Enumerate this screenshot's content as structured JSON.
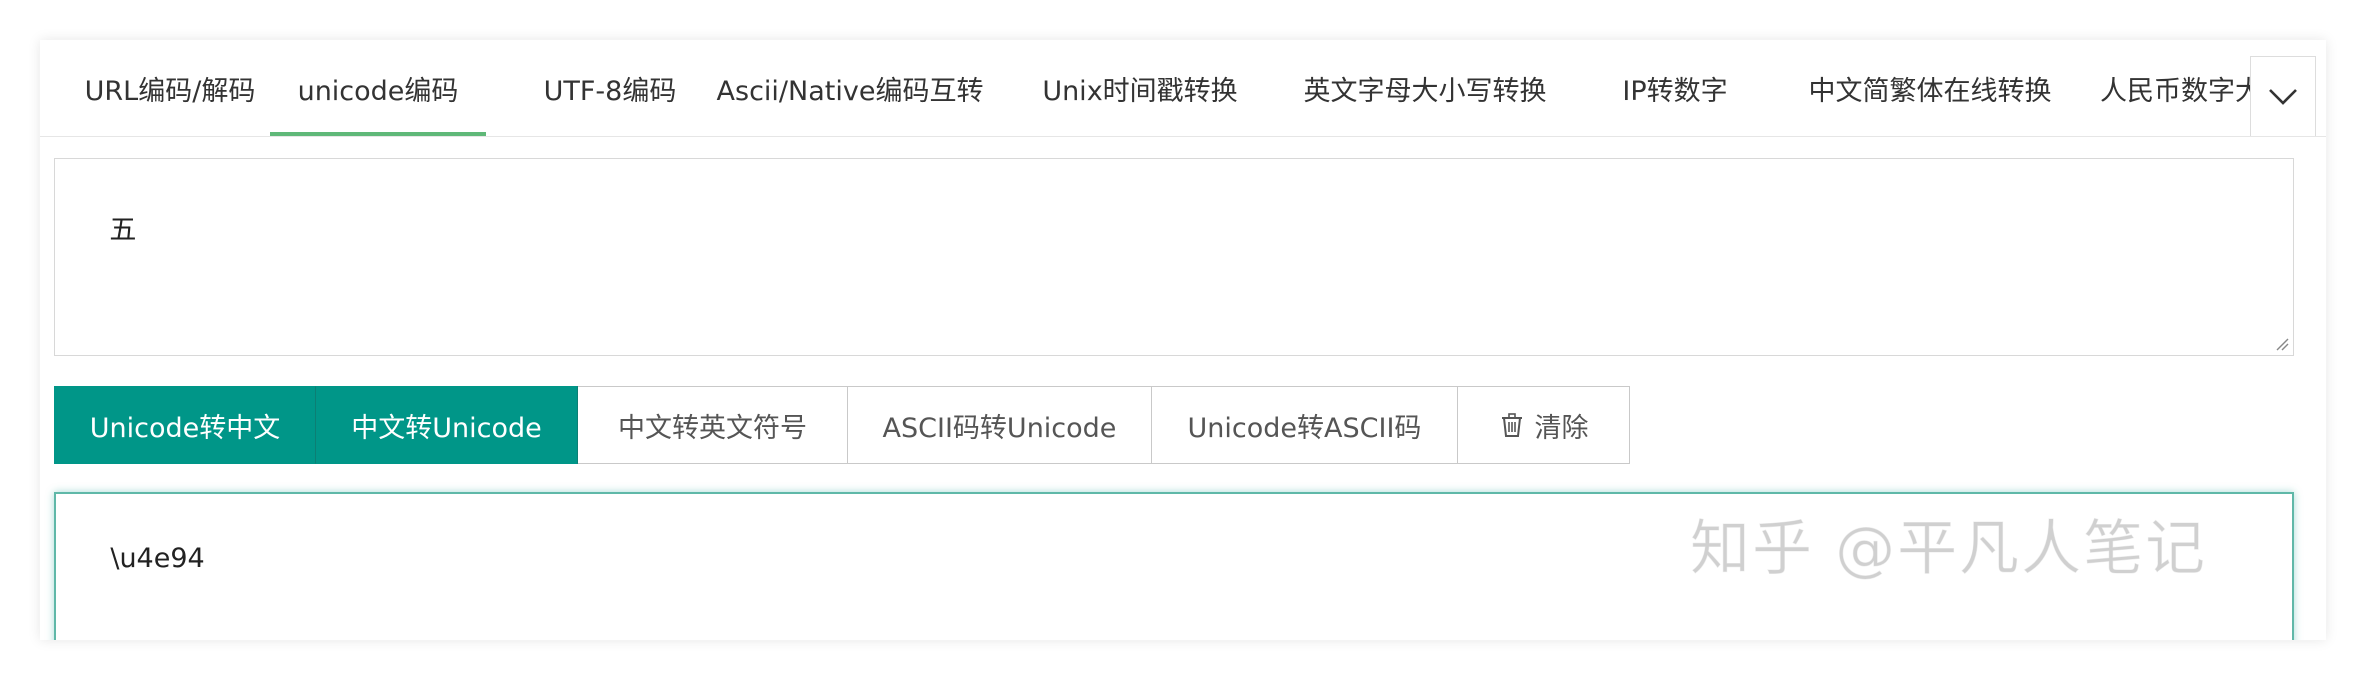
{
  "tabs": [
    {
      "label": "URL编码/解码",
      "active": false
    },
    {
      "label": "unicode编码",
      "active": true
    },
    {
      "label": "UTF-8编码",
      "active": false
    },
    {
      "label": "Ascii/Native编码互转",
      "active": false
    },
    {
      "label": "Unix时间戳转换",
      "active": false
    },
    {
      "label": "英文字母大小写转换",
      "active": false
    },
    {
      "label": "IP转数字",
      "active": false
    },
    {
      "label": "中文简繁体在线转换",
      "active": false
    },
    {
      "label": "人民币数字大",
      "active": false
    }
  ],
  "input": {
    "value": "五"
  },
  "buttons": [
    {
      "label": "Unicode转中文"
    },
    {
      "label": "中文转Unicode"
    },
    {
      "label": "中文转英文符号"
    },
    {
      "label": "ASCII码转Unicode"
    },
    {
      "label": "Unicode转ASCII码"
    },
    {
      "label": "清除"
    }
  ],
  "output": {
    "value": "\\u4e94"
  },
  "watermark": "知乎 @平凡人笔记",
  "colors": {
    "accent": "#009688",
    "tab_underline": "#5fb878"
  }
}
